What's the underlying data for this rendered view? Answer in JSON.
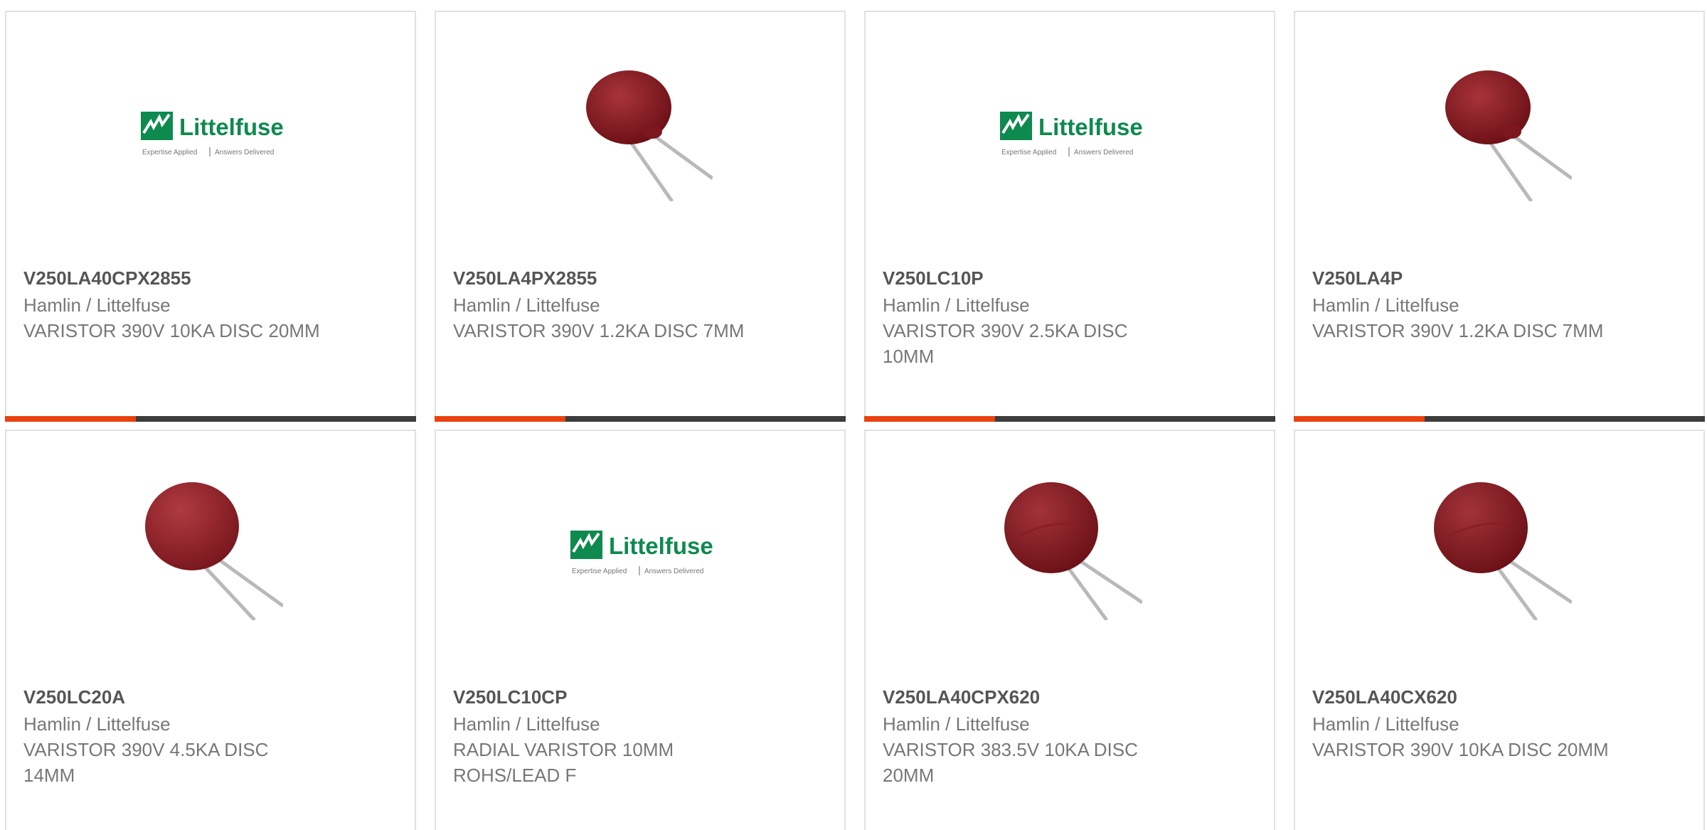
{
  "theme": {
    "accent_color": "#e8420f",
    "bar_color": "#3c3c3c",
    "logo_green": "#0e8a4f",
    "varistor_color": "#8b1c22"
  },
  "products": [
    {
      "sku": "V250LA40CPX2855",
      "brand": "Hamlin / Littelfuse",
      "description": "VARISTOR 390V 10KA DISC 20MM",
      "image": "littelfuse-logo"
    },
    {
      "sku": "V250LA4PX2855",
      "brand": "Hamlin / Littelfuse",
      "description": "VARISTOR 390V 1.2KA DISC 7MM",
      "image": "varistor-disc"
    },
    {
      "sku": "V250LC10P",
      "brand": "Hamlin / Littelfuse",
      "description": "VARISTOR 390V 2.5KA DISC 10MM",
      "image": "littelfuse-logo"
    },
    {
      "sku": "V250LA4P",
      "brand": "Hamlin / Littelfuse",
      "description": "VARISTOR 390V 1.2KA DISC 7MM",
      "image": "varistor-disc"
    },
    {
      "sku": "V250LC20A",
      "brand": "Hamlin / Littelfuse",
      "description": "VARISTOR 390V 4.5KA DISC 14MM",
      "image": "varistor-disc-large"
    },
    {
      "sku": "V250LC10CP",
      "brand": "Hamlin / Littelfuse",
      "description": "RADIAL VARISTOR 10MM ROHS/LEAD F",
      "image": "littelfuse-logo"
    },
    {
      "sku": "V250LA40CPX620",
      "brand": "Hamlin / Littelfuse",
      "description": "VARISTOR 383.5V 10KA DISC 20MM",
      "image": "varistor-disc-large"
    },
    {
      "sku": "V250LA40CX620",
      "brand": "Hamlin / Littelfuse",
      "description": "VARISTOR 390V 10KA DISC 20MM",
      "image": "varistor-disc-large"
    }
  ],
  "logo": {
    "wordmark": "Littelfuse",
    "tagline_left": "Expertise Applied",
    "tagline_right": "Answers Delivered"
  }
}
